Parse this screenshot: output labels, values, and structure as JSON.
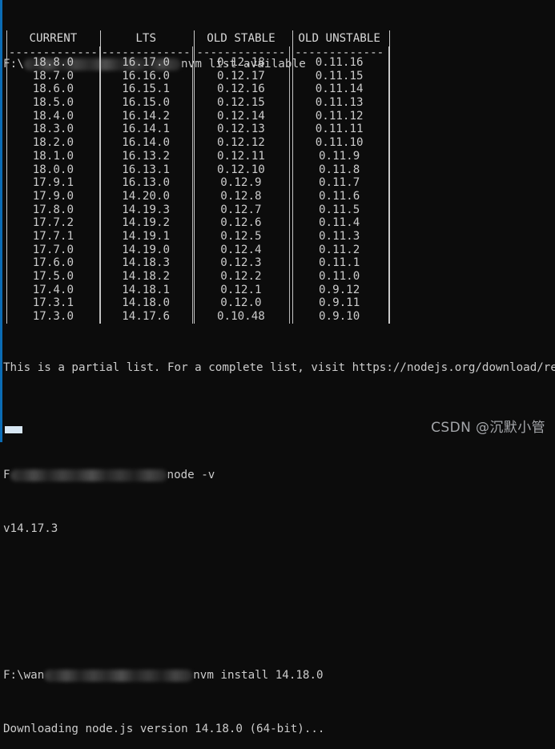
{
  "window": {
    "background_color": "#0c0c0c",
    "foreground_color": "#cccccc",
    "accent_color": "#0b6cb5",
    "border_color": "#c8c8c8"
  },
  "prompts": {
    "line1_prefix": "F:\\",
    "line1_command": "nvm list available",
    "line2_prefix": "F",
    "line2_command": "node -v",
    "line2_output": "v14.17.3",
    "line3_prefix": "F:\\wan",
    "line3_command": "nvm install 14.18.0",
    "line3_output": "Downloading node.js version 14.18.0 (64-bit)...",
    "redacted_label": "redacted-path"
  },
  "table": {
    "headers": [
      "CURRENT",
      "LTS",
      "OLD STABLE",
      "OLD UNSTABLE"
    ],
    "rule": "-------------",
    "rows": [
      [
        "18.8.0",
        "16.17.0",
        "0.12.18",
        "0.11.16"
      ],
      [
        "18.7.0",
        "16.16.0",
        "0.12.17",
        "0.11.15"
      ],
      [
        "18.6.0",
        "16.15.1",
        "0.12.16",
        "0.11.14"
      ],
      [
        "18.5.0",
        "16.15.0",
        "0.12.15",
        "0.11.13"
      ],
      [
        "18.4.0",
        "16.14.2",
        "0.12.14",
        "0.11.12"
      ],
      [
        "18.3.0",
        "16.14.1",
        "0.12.13",
        "0.11.11"
      ],
      [
        "18.2.0",
        "16.14.0",
        "0.12.12",
        "0.11.10"
      ],
      [
        "18.1.0",
        "16.13.2",
        "0.12.11",
        "0.11.9"
      ],
      [
        "18.0.0",
        "16.13.1",
        "0.12.10",
        "0.11.8"
      ],
      [
        "17.9.1",
        "16.13.0",
        "0.12.9",
        "0.11.7"
      ],
      [
        "17.9.0",
        "14.20.0",
        "0.12.8",
        "0.11.6"
      ],
      [
        "17.8.0",
        "14.19.3",
        "0.12.7",
        "0.11.5"
      ],
      [
        "17.7.2",
        "14.19.2",
        "0.12.6",
        "0.11.4"
      ],
      [
        "17.7.1",
        "14.19.1",
        "0.12.5",
        "0.11.3"
      ],
      [
        "17.7.0",
        "14.19.0",
        "0.12.4",
        "0.11.2"
      ],
      [
        "17.6.0",
        "14.18.3",
        "0.12.3",
        "0.11.1"
      ],
      [
        "17.5.0",
        "14.18.2",
        "0.12.2",
        "0.11.0"
      ],
      [
        "17.4.0",
        "14.18.1",
        "0.12.1",
        "0.9.12"
      ],
      [
        "17.3.1",
        "14.18.0",
        "0.12.0",
        "0.9.11"
      ],
      [
        "17.3.0",
        "14.17.6",
        "0.10.48",
        "0.9.10"
      ]
    ]
  },
  "footer": {
    "partial_list_notice": "This is a partial list. For a complete list, visit https://nodejs.org/download/release",
    "release_url": "https://nodejs.org/download/release"
  },
  "watermark": {
    "text": "CSDN @沉默小管"
  }
}
